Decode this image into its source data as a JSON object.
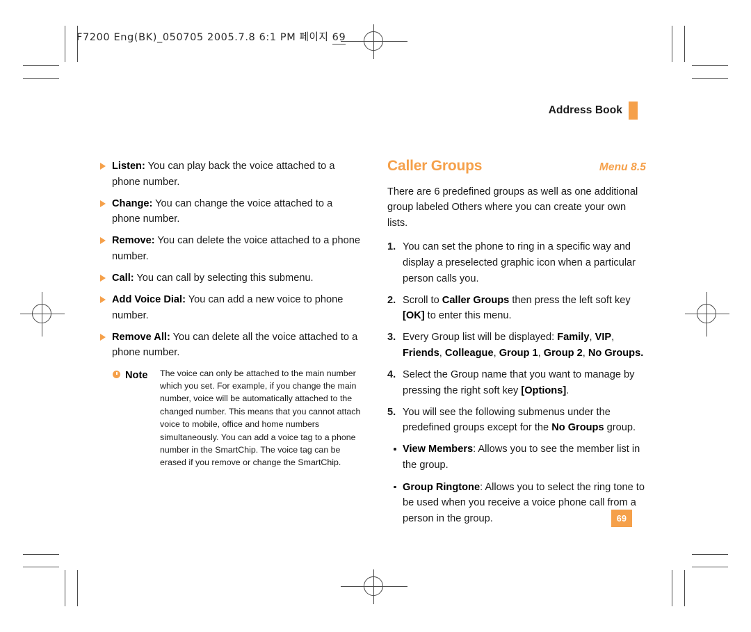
{
  "proof_header": {
    "text": "F7200 Eng(BK)_050705  2005.7.8  6:1 PM",
    "korean": "페이지",
    "page": "69"
  },
  "running_head": {
    "title": "Address Book",
    "accent_color": "#F5A04A"
  },
  "left_column": {
    "items": [
      {
        "term": "Listen:",
        "text": " You can play back the voice attached to a phone number."
      },
      {
        "term": "Change:",
        "text": " You can change the voice attached to a phone number."
      },
      {
        "term": "Remove:",
        "text": " You can delete the voice attached to a phone number."
      },
      {
        "term": "Call:",
        "text": " You can call by selecting this submenu."
      },
      {
        "term": "Add Voice Dial:",
        "text": " You can add a new voice to phone number."
      },
      {
        "term": "Remove All:",
        "text": " You can delete all the voice attached to a phone number."
      }
    ],
    "note": {
      "label": "Note",
      "body": "The voice can only be attached to the main number which you set. For example, if you change the main number, voice will be automatically attached to the changed number. This means that you cannot attach voice to mobile, office and home numbers simultaneously. You can add a voice tag to a phone number in the SmartChip. The voice tag can be erased if you remove or change the SmartChip."
    }
  },
  "right_column": {
    "section_title": "Caller Groups",
    "menu_label": "Menu 8.5",
    "intro": "There are 6 predefined groups as well as one additional group labeled Others where you can create your own lists.",
    "steps": [
      {
        "number": "1.",
        "html": "You can set the phone to ring in a specific way and display a preselected graphic icon when a particular person calls you."
      },
      {
        "number": "2.",
        "html": "Scroll to <b>Caller Groups</b> then press the left soft key <b>[OK]</b> to enter this menu."
      },
      {
        "number": "3.",
        "html": "Every Group list will be displayed: <b>Family</b>, <b>VIP</b>, <b>Friends</b>, <b>Colleague</b>, <b>Group 1</b>, <b>Group 2</b>, <b>No Groups.</b>"
      },
      {
        "number": "4.",
        "html": "Select the Group name that you want to manage by pressing the right soft key <b>[Options]</b>."
      },
      {
        "number": "5.",
        "html": "You will see the following submenus under the predefined groups except for the <b>No Groups</b> group."
      }
    ],
    "submenus": [
      {
        "html": "<b>View Members</b>: Allows you to see the member list in the group."
      },
      {
        "html": "<b>Group Ringtone</b>: Allows you to select the ring tone to be used when you receive a voice phone call from a person in the group."
      }
    ]
  },
  "page_number": "69"
}
